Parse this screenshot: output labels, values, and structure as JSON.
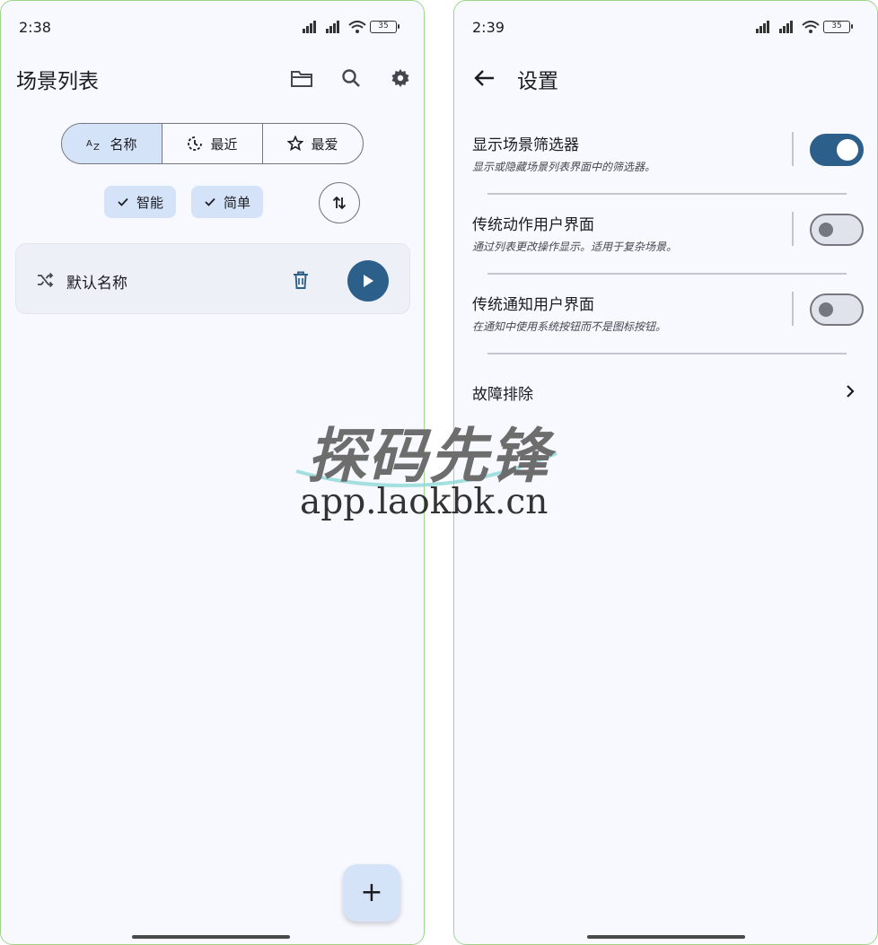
{
  "left": {
    "status": {
      "time": "2:38",
      "battery": "35"
    },
    "title": "场景列表",
    "sort_tabs": [
      {
        "label": "名称",
        "icon": "sort-az-icon",
        "active": true
      },
      {
        "label": "最近",
        "icon": "history-icon",
        "active": false
      },
      {
        "label": "最爱",
        "icon": "star-icon",
        "active": false
      }
    ],
    "filter_chips": [
      {
        "label": "智能",
        "selected": true
      },
      {
        "label": "简单",
        "selected": true
      }
    ],
    "scenes": [
      {
        "name": "默认名称"
      }
    ],
    "fab_symbol": "+"
  },
  "right": {
    "status": {
      "time": "2:39",
      "battery": "35"
    },
    "title": "设置",
    "settings": [
      {
        "title": "显示场景筛选器",
        "description": "显示或隐藏场景列表界面中的筛选器。",
        "enabled": true
      },
      {
        "title": "传统动作用户界面",
        "description": "通过列表更改操作显示。适用于复杂场景。",
        "enabled": false
      },
      {
        "title": "传统通知用户界面",
        "description": "在通知中使用系统按钮而不是图标按钮。",
        "enabled": false
      }
    ],
    "troubleshoot_label": "故障排除"
  },
  "watermark": {
    "title": "探码先锋",
    "url": "app.laokbk.cn"
  },
  "colors": {
    "accent": "#2d5f8b",
    "chip": "#d4e3f8",
    "background": "#f8f9ff"
  }
}
